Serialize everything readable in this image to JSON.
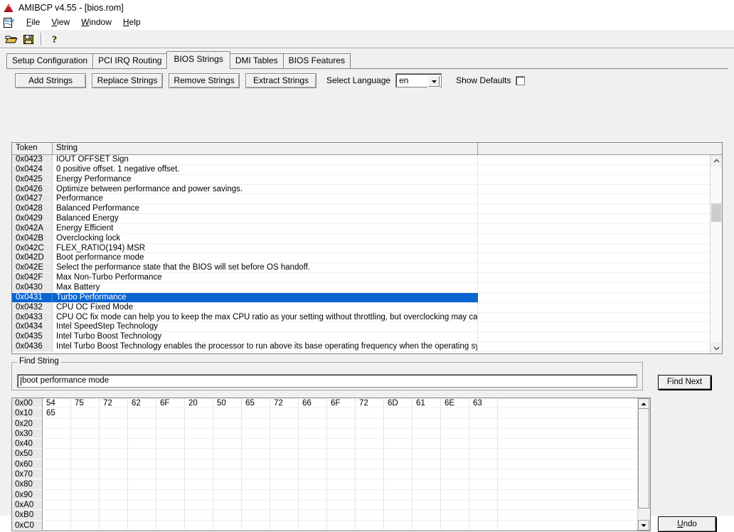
{
  "window": {
    "title": "AMIBCP v4.55 - [bios.rom]",
    "app_icon": "amibcp-mountain-icon",
    "document_icon": "rom-document-icon"
  },
  "menu": {
    "items": [
      {
        "label": "File",
        "accel": "F"
      },
      {
        "label": "View",
        "accel": "V"
      },
      {
        "label": "Window",
        "accel": "W"
      },
      {
        "label": "Help",
        "accel": "H"
      }
    ]
  },
  "toolbar": {
    "buttons": [
      {
        "name": "open-file-button",
        "icon": "open-folder-icon"
      },
      {
        "name": "save-file-button",
        "icon": "floppy-disk-icon"
      },
      {
        "name": "help-button",
        "icon": "question-mark-icon"
      }
    ]
  },
  "tabs": [
    {
      "label": "Setup Configuration",
      "active": false
    },
    {
      "label": "PCI IRQ Routing",
      "active": false
    },
    {
      "label": "BIOS Strings",
      "active": true
    },
    {
      "label": "DMI Tables",
      "active": false
    },
    {
      "label": "BIOS Features",
      "active": false
    }
  ],
  "actions": {
    "add_strings": "Add Strings",
    "replace_strings": "Replace Strings",
    "remove_strings": "Remove Strings",
    "extract_strings": "Extract Strings",
    "select_language_label": "Select Language",
    "language_value": "en",
    "language_options": [
      "en"
    ],
    "show_defaults_label": "Show Defaults",
    "show_defaults_checked": false
  },
  "strings_list": {
    "columns": [
      "Token",
      "String"
    ],
    "rows": [
      {
        "token": "0x0423",
        "string": "IOUT OFFSET Sign",
        "selected": false
      },
      {
        "token": "0x0424",
        "string": "0 positive offset. 1 negative offset.",
        "selected": false
      },
      {
        "token": "0x0425",
        "string": "Energy Performance",
        "selected": false
      },
      {
        "token": "0x0426",
        "string": "Optimize between performance and power savings.",
        "selected": false
      },
      {
        "token": "0x0427",
        "string": "Performance",
        "selected": false
      },
      {
        "token": "0x0428",
        "string": "Balanced Performance",
        "selected": false
      },
      {
        "token": "0x0429",
        "string": "Balanced Energy",
        "selected": false
      },
      {
        "token": "0x042A",
        "string": "Energy Efficient",
        "selected": false
      },
      {
        "token": "0x042B",
        "string": "Overclocking lock",
        "selected": false
      },
      {
        "token": "0x042C",
        "string": "FLEX_RATIO(194) MSR",
        "selected": false
      },
      {
        "token": "0x042D",
        "string": "Boot performance mode",
        "selected": false
      },
      {
        "token": "0x042E",
        "string": "Select the performance state that the BIOS will set before OS handoff.",
        "selected": false
      },
      {
        "token": "0x042F",
        "string": "Max Non-Turbo Performance",
        "selected": false
      },
      {
        "token": "0x0430",
        "string": "Max Battery",
        "selected": false
      },
      {
        "token": "0x0431",
        "string": "Turbo Performance",
        "selected": true
      },
      {
        "token": "0x0432",
        "string": "CPU OC Fixed Mode",
        "selected": false
      },
      {
        "token": "0x0433",
        "string": "CPU OC fix mode can help you to keep the max CPU ratio as your setting without throttling, but overclocking may cause da...",
        "selected": false
      },
      {
        "token": "0x0434",
        "string": "Intel SpeedStep Technology",
        "selected": false
      },
      {
        "token": "0x0435",
        "string": "Intel Turbo Boost Technology",
        "selected": false
      },
      {
        "token": "0x0436",
        "string": "Intel Turbo Boost Technology enables the processor to run above its base operating frequency  when the operating system...",
        "selected": false
      }
    ]
  },
  "find": {
    "group_title": "Find String",
    "value": "boot performance mode",
    "placeholder": "",
    "find_next_label": "Find Next"
  },
  "hex": {
    "rows": [
      {
        "addr": "0x00",
        "bytes": [
          "54",
          "75",
          "72",
          "62",
          "6F",
          "20",
          "50",
          "65",
          "72",
          "66",
          "6F",
          "72",
          "6D",
          "61",
          "6E",
          "63"
        ]
      },
      {
        "addr": "0x10",
        "bytes": [
          "65",
          "",
          "",
          "",
          "",
          "",
          "",
          "",
          "",
          "",
          "",
          "",
          "",
          "",
          "",
          ""
        ]
      },
      {
        "addr": "0x20",
        "bytes": [
          "",
          "",
          "",
          "",
          "",
          "",
          "",
          "",
          "",
          "",
          "",
          "",
          "",
          "",
          "",
          ""
        ]
      },
      {
        "addr": "0x30",
        "bytes": [
          "",
          "",
          "",
          "",
          "",
          "",
          "",
          "",
          "",
          "",
          "",
          "",
          "",
          "",
          "",
          ""
        ]
      },
      {
        "addr": "0x40",
        "bytes": [
          "",
          "",
          "",
          "",
          "",
          "",
          "",
          "",
          "",
          "",
          "",
          "",
          "",
          "",
          "",
          ""
        ]
      },
      {
        "addr": "0x50",
        "bytes": [
          "",
          "",
          "",
          "",
          "",
          "",
          "",
          "",
          "",
          "",
          "",
          "",
          "",
          "",
          "",
          ""
        ]
      },
      {
        "addr": "0x60",
        "bytes": [
          "",
          "",
          "",
          "",
          "",
          "",
          "",
          "",
          "",
          "",
          "",
          "",
          "",
          "",
          "",
          ""
        ]
      },
      {
        "addr": "0x70",
        "bytes": [
          "",
          "",
          "",
          "",
          "",
          "",
          "",
          "",
          "",
          "",
          "",
          "",
          "",
          "",
          "",
          ""
        ]
      },
      {
        "addr": "0x80",
        "bytes": [
          "",
          "",
          "",
          "",
          "",
          "",
          "",
          "",
          "",
          "",
          "",
          "",
          "",
          "",
          "",
          ""
        ]
      },
      {
        "addr": "0x90",
        "bytes": [
          "",
          "",
          "",
          "",
          "",
          "",
          "",
          "",
          "",
          "",
          "",
          "",
          "",
          "",
          "",
          ""
        ]
      },
      {
        "addr": "0xA0",
        "bytes": [
          "",
          "",
          "",
          "",
          "",
          "",
          "",
          "",
          "",
          "",
          "",
          "",
          "",
          "",
          "",
          ""
        ]
      },
      {
        "addr": "0xB0",
        "bytes": [
          "",
          "",
          "",
          "",
          "",
          "",
          "",
          "",
          "",
          "",
          "",
          "",
          "",
          "",
          "",
          ""
        ]
      },
      {
        "addr": "0xC0",
        "bytes": [
          "",
          "",
          "",
          "",
          "",
          "",
          "",
          "",
          "",
          "",
          "",
          "",
          "",
          "",
          "",
          ""
        ]
      }
    ]
  },
  "footer": {
    "undo_label": "Undo",
    "undo_accel": "U"
  },
  "colors": {
    "selection": "#0a64d2",
    "selection_text": "#ffffff",
    "face": "#f0f0f0",
    "row_header": "#e8e8e8"
  }
}
